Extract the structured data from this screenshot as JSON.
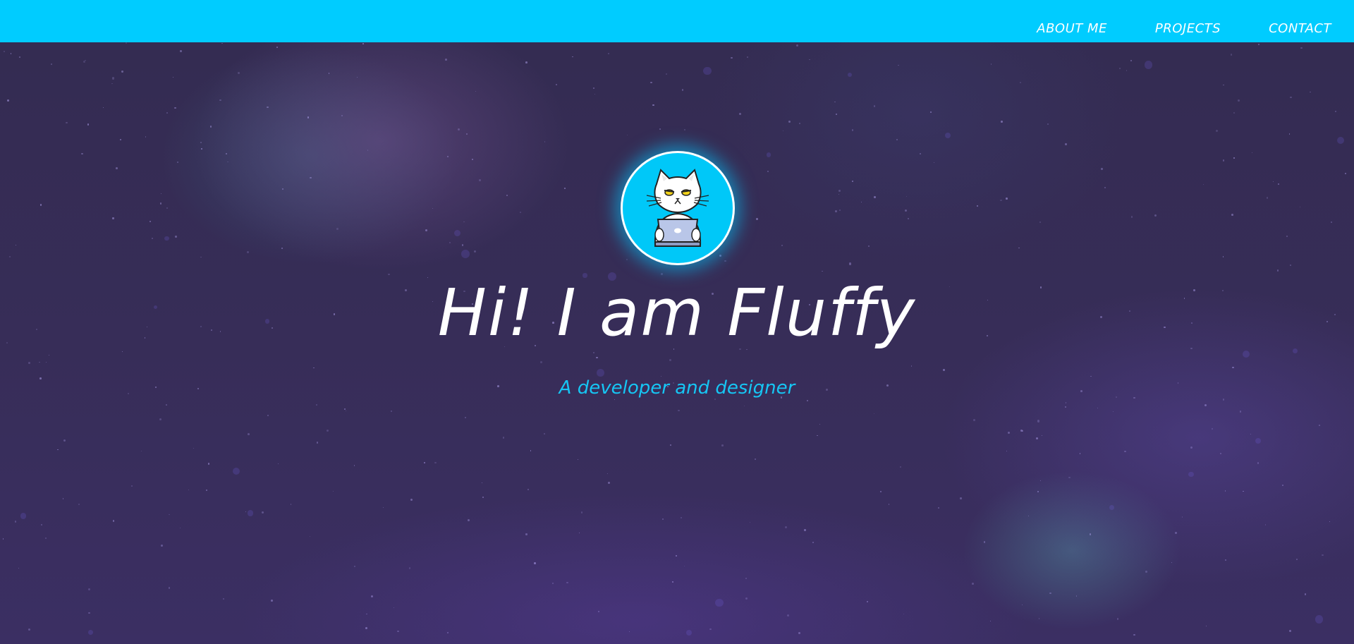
{
  "nav": {
    "items": [
      {
        "label": "ABOUT ME"
      },
      {
        "label": "PROJECTS"
      },
      {
        "label": "CONTACT"
      }
    ]
  },
  "hero": {
    "title": "Hi! I am Fluffy",
    "subtitle": "A developer and designer",
    "avatar_icon": "cat-with-laptop-icon"
  },
  "colors": {
    "topbar": "#00ccff",
    "background": "#352d55",
    "title": "#ffffff",
    "subtitle": "#16c6f4",
    "avatar_bg": "#00c8f8"
  }
}
